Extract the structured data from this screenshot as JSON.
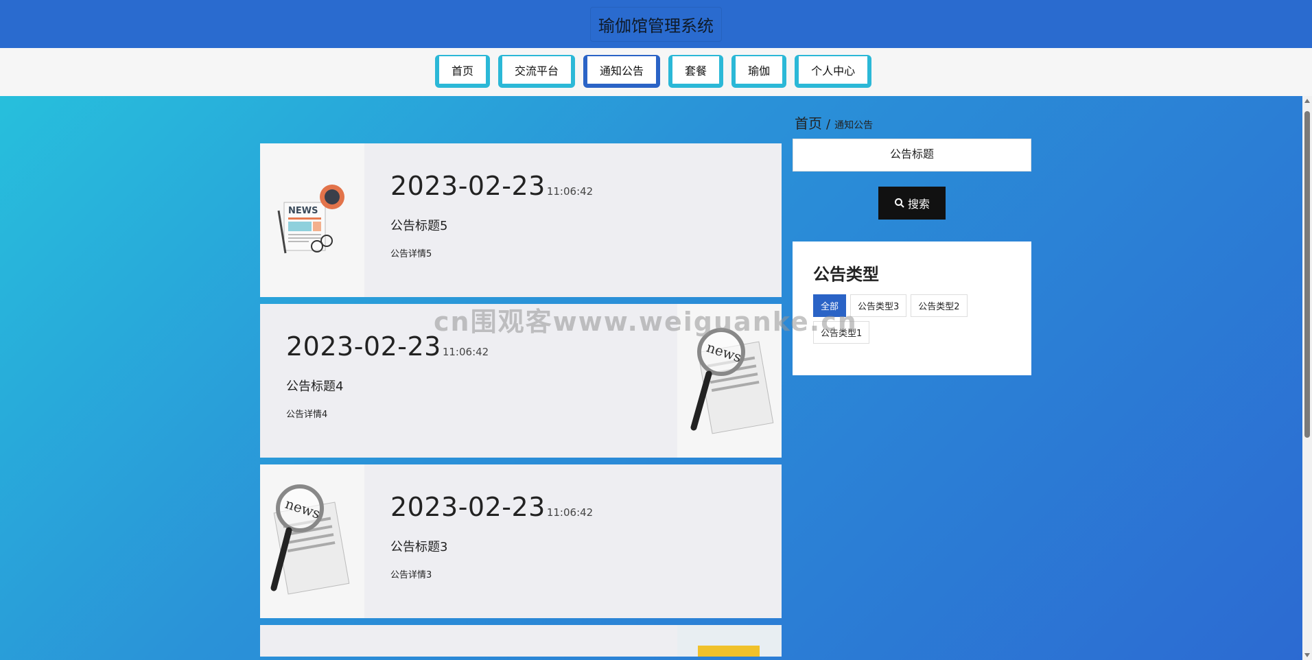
{
  "header": {
    "title": "瑜伽馆管理系统"
  },
  "nav": {
    "items": [
      {
        "label": "首页",
        "active": false
      },
      {
        "label": "交流平台",
        "active": false
      },
      {
        "label": "通知公告",
        "active": true
      },
      {
        "label": "套餐",
        "active": false
      },
      {
        "label": "瑜伽",
        "active": false
      },
      {
        "label": "个人中心",
        "active": false
      }
    ]
  },
  "notices": [
    {
      "date": "2023-02-23",
      "time": "11:06:42",
      "title": "公告标题5",
      "detail": "公告详情5",
      "image": "news-flatlay-icon",
      "image_side": "left"
    },
    {
      "date": "2023-02-23",
      "time": "11:06:42",
      "title": "公告标题4",
      "detail": "公告详情4",
      "image": "newspaper-magnifier-icon",
      "image_side": "right"
    },
    {
      "date": "2023-02-23",
      "time": "11:06:42",
      "title": "公告标题3",
      "detail": "公告详情3",
      "image": "newspaper-magnifier-icon",
      "image_side": "left"
    }
  ],
  "breadcrumb": {
    "home": "首页",
    "separator": "/",
    "current": "通知公告"
  },
  "search": {
    "placeholder": "公告标题",
    "button_label": "搜索"
  },
  "types": {
    "heading": "公告类型",
    "items": [
      "全部",
      "公告类型3",
      "公告类型2",
      "公告类型1"
    ],
    "active": "全部"
  },
  "watermark": "cn围观客www.weiguanke.cn",
  "colors": {
    "header_bg": "#2a6bcf",
    "nav_border": "#2bb8d7",
    "nav_active_border": "#2a63c6",
    "gradient_start": "#27bfdc",
    "gradient_end": "#2c6ad2",
    "card_bg": "#eeeef2",
    "search_button_bg": "#111111",
    "tag_active_bg": "#2a63c6"
  }
}
